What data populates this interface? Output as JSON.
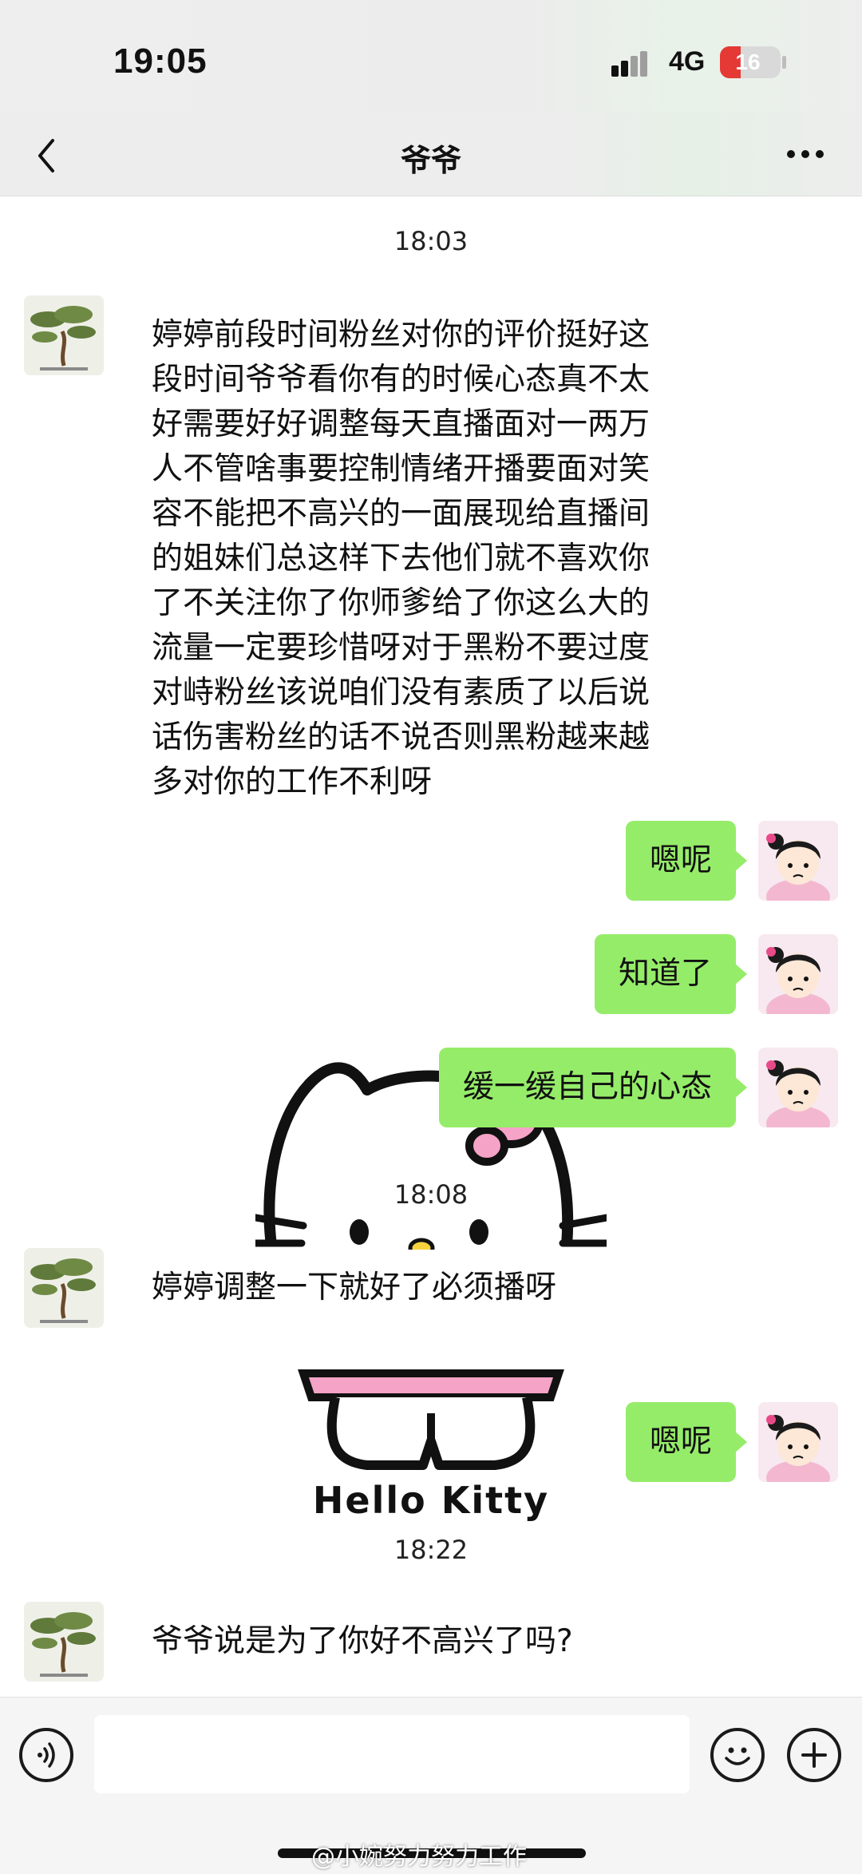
{
  "status_bar": {
    "time": "19:05",
    "network": "4G",
    "battery": "16"
  },
  "nav": {
    "title": "爷爷"
  },
  "messages": {
    "ts1": "18:03",
    "m1_lines": [
      "婷婷前段时间粉丝对你的评价挺好这",
      "段时间爷爷看你有的时候心态真不太",
      "好需要好好调整每天直播面对一两万",
      "人不管啥事要控制情绪开播要面对笑",
      "容不能把不高兴的一面展现给直播间",
      "的姐妹们总这样下去他们就不喜欢你",
      "了不关注你了你师爹给了你这么大的",
      "流量一定要珍惜呀对于黑粉不要过度",
      "对峙粉丝该说咱们没有素质了以后说",
      "话伤害粉丝的话不说否则黑粉越来越",
      "多对你的工作不利呀"
    ],
    "r1": "嗯呢",
    "r2": "知道了",
    "r3": "缓一缓自己的心态",
    "ts2": "18:08",
    "m2": "婷婷调整一下就好了必须播呀",
    "r4": "嗯呢",
    "sticker_text": "Hello Kitty",
    "ts3": "18:22",
    "m3": "爷爷说是为了你好不高兴了吗?"
  },
  "watermark": "@小婉努力努力工作",
  "icons": {
    "back": "back-icon",
    "more": "more-icon",
    "voice": "voice-icon",
    "emoji": "emoji-icon",
    "plus": "plus-icon"
  },
  "colors": {
    "bubble": "#95ec69",
    "background": "#ffffff",
    "bar": "#ededed"
  }
}
